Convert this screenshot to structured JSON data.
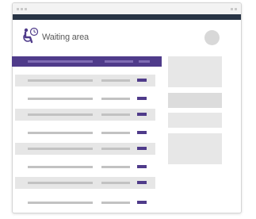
{
  "app": {
    "title": "Waiting area",
    "icon": "wheelchair-clock-icon",
    "accent_color": "#4f3b8a",
    "topbar_color": "#283445"
  },
  "table": {
    "header_cells": [
      "",
      "",
      ""
    ],
    "rows": [
      {
        "name": "",
        "qty": "",
        "tag": ""
      },
      {
        "name": "",
        "qty": "",
        "tag": ""
      },
      {
        "name": "",
        "qty": "",
        "tag": ""
      },
      {
        "name": "",
        "qty": "",
        "tag": ""
      },
      {
        "name": "",
        "qty": "",
        "tag": ""
      },
      {
        "name": "",
        "qty": "",
        "tag": ""
      },
      {
        "name": "",
        "qty": "",
        "tag": ""
      },
      {
        "name": "",
        "qty": "",
        "tag": ""
      }
    ]
  }
}
